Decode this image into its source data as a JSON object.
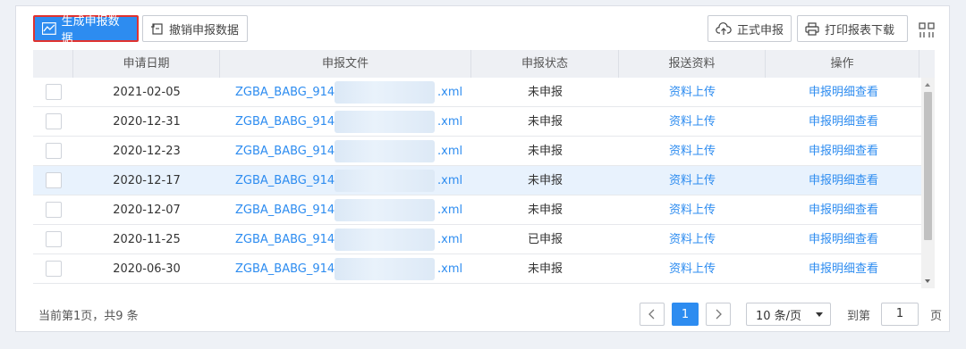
{
  "toolbar": {
    "generate": "生成申报数据",
    "revoke": "撤销申报数据",
    "formal": "正式申报",
    "print": "打印报表下载"
  },
  "columns": [
    "申请日期",
    "申报文件",
    "申报状态",
    "报送资料",
    "操作"
  ],
  "rows": [
    {
      "date": "2021-02-05",
      "file": "ZGBA_BABG_914",
      "ext": ".xml",
      "status": "未申报",
      "upload": "资料上传",
      "detail": "申报明细查看"
    },
    {
      "date": "2020-12-31",
      "file": "ZGBA_BABG_914",
      "ext": ".xml",
      "status": "未申报",
      "upload": "资料上传",
      "detail": "申报明细查看"
    },
    {
      "date": "2020-12-23",
      "file": "ZGBA_BABG_914",
      "ext": ".xml",
      "status": "未申报",
      "upload": "资料上传",
      "detail": "申报明细查看"
    },
    {
      "date": "2020-12-17",
      "file": "ZGBA_BABG_914",
      "ext": ".xml",
      "status": "未申报",
      "upload": "资料上传",
      "detail": "申报明细查看"
    },
    {
      "date": "2020-12-07",
      "file": "ZGBA_BABG_914",
      "ext": ".xml",
      "status": "未申报",
      "upload": "资料上传",
      "detail": "申报明细查看"
    },
    {
      "date": "2020-11-25",
      "file": "ZGBA_BABG_914",
      "ext": ".xml",
      "status": "已申报",
      "upload": "资料上传",
      "detail": "申报明细查看"
    },
    {
      "date": "2020-06-30",
      "file": "ZGBA_BABG_914",
      "ext": ".xml",
      "status": "未申报",
      "upload": "资料上传",
      "detail": "申报明细查看"
    }
  ],
  "footer": {
    "summary": "当前第1页，共9 条",
    "current_page": "1",
    "page_size": "10 条/页",
    "goto_label": "到第",
    "goto_value": "1",
    "page_suffix": "页"
  },
  "colors": {
    "accent": "#2d8cf0",
    "highlight_border": "#e0322f",
    "row_hover": "#e8f2fd"
  }
}
